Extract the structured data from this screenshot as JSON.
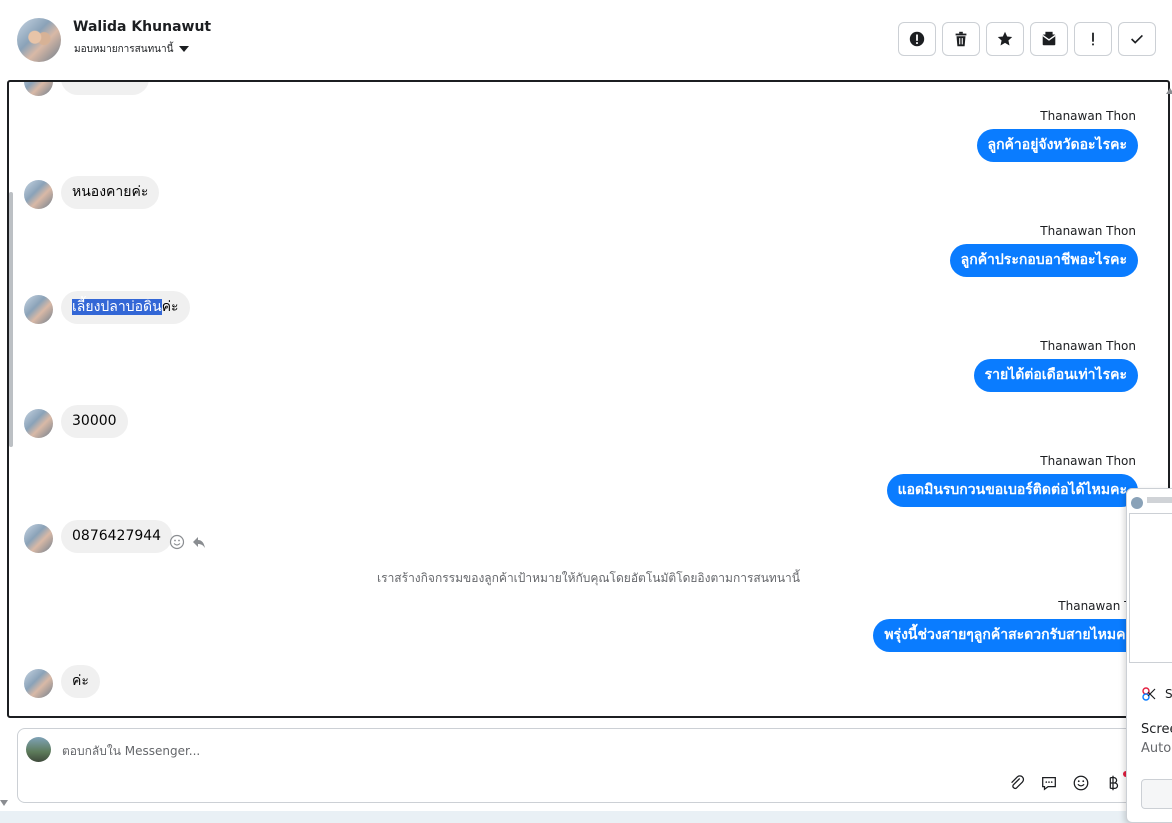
{
  "header": {
    "contact_name": "Walida Khunawut",
    "assign_label": "มอบหมายการสนทนานี้"
  },
  "toolbar": {
    "buttons": [
      {
        "icon": "alert-circle-icon"
      },
      {
        "icon": "trash-icon"
      },
      {
        "icon": "star-icon"
      },
      {
        "icon": "mark-unread-icon"
      },
      {
        "icon": "exclamation-icon"
      },
      {
        "icon": "check-icon"
      }
    ]
  },
  "messages": {
    "in_1": "หนองคายค่ะ",
    "in_2_highlighted": "เลี้ยงปลาบ่อดิน",
    "in_2_rest": "ค่ะ",
    "in_3": "30000",
    "in_4": "0876427944",
    "in_5": "ค่ะ",
    "out_name": "Thanawan Thon",
    "out_1": "ลูกค้าอยู่จังหวัดอะไรคะ",
    "out_2": "ลูกค้าประกอบอาชีพอะไรคะ",
    "out_3": "รายได้ต่อเดือนเท่าไรคะ",
    "out_4": "แอดมินรบกวนขอเบอร์ติดต่อได้ไหมคะ",
    "out_5": "พรุ่งนี้ช่วงสายๆลูกค้าสะดวกรับสายไหมคะ",
    "system_note": "เราสร้างกิจกรรมของลูกค้าเป้าหมายให้กับคุณโดยอัตโนมัติโดยอิงตามการสนทนานี้"
  },
  "composer": {
    "placeholder": "ตอบกลับใน Messenger..."
  },
  "popup": {
    "app_label": "S",
    "line1": "Scree",
    "line2": "Auto"
  },
  "colors": {
    "outgoing_bubble": "#0a7cff",
    "incoming_bubble": "#f0f0f0",
    "selection": "#3367d6"
  }
}
